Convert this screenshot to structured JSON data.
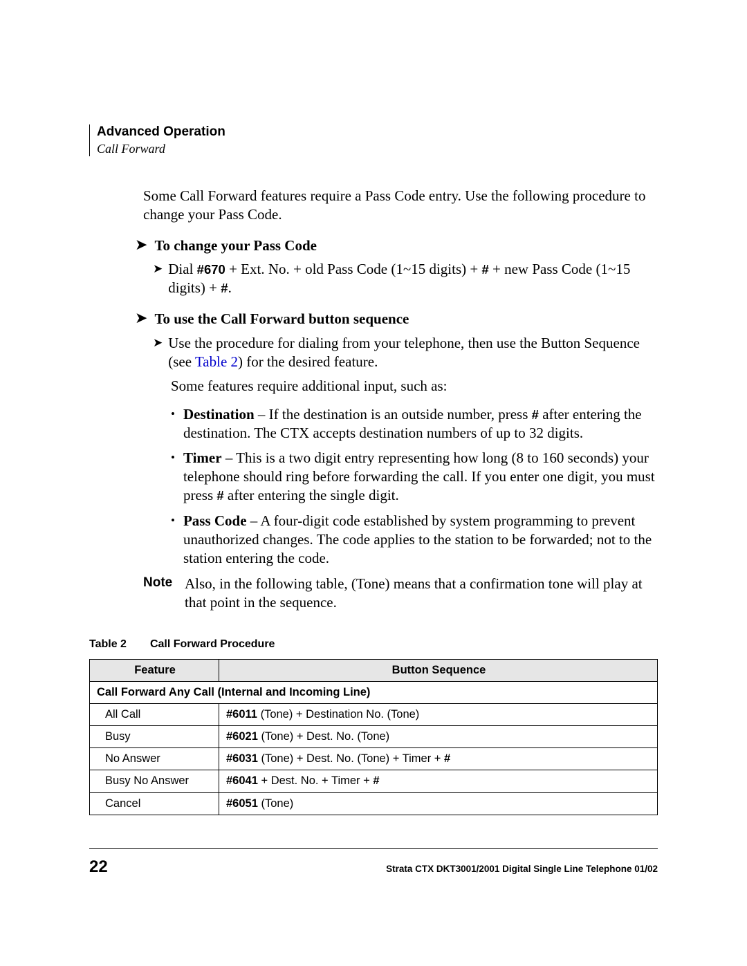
{
  "header": {
    "title": "Advanced Operation",
    "subtitle": "Call Forward"
  },
  "intro": "Some Call Forward features require a Pass Code entry. Use the following procedure to change your Pass Code.",
  "proc1": {
    "title": "To change your Pass Code",
    "step_pre": "Dial ",
    "step_code": "#670",
    "step_mid": " + Ext. No. + old Pass Code (1~15 digits) + ",
    "step_hash1": "#",
    "step_mid2": " + new Pass Code (1~15 digits) + ",
    "step_hash2": "#",
    "step_end": "."
  },
  "proc2": {
    "title": "To use the Call Forward button sequence",
    "step_a_pre": "Use the procedure for dialing from your telephone, then use the Button Sequence (see ",
    "step_a_link": "Table 2",
    "step_a_post": ") for the desired feature.",
    "step_b": "Some features require additional input, such as:",
    "bullets": {
      "dest_label": "Destination",
      "dest_pre": " – If the destination is an outside number, press ",
      "dest_hash": "#",
      "dest_post": " after entering the destination. The CTX accepts destination numbers of up to 32 digits.",
      "timer_label": "Timer",
      "timer_pre": " – This is a two digit entry representing how long (8 to 160 seconds) your telephone should ring before forwarding the call. If you enter one digit, you must press ",
      "timer_hash": "#",
      "timer_post": " after entering the single digit.",
      "pass_label": "Pass Code",
      "pass_text": " – A four-digit code established by system programming to prevent unauthorized changes. The code applies to the station to be forwarded; not to the station entering the code."
    },
    "note_label": "Note",
    "note_text": "Also, in the following table, (Tone) means that a confirmation tone will play at that point in the sequence."
  },
  "table": {
    "caption_label": "Table 2",
    "caption_title": "Call Forward Procedure",
    "h_feature": "Feature",
    "h_seq": "Button Sequence",
    "section": "Call Forward Any Call (Internal and Incoming Line)",
    "rows": [
      {
        "feature": "All Call",
        "code": "#6011",
        "rest": " (Tone) + Destination No. (Tone)"
      },
      {
        "feature": "Busy",
        "code": "#6021",
        "rest": " (Tone) + Dest. No. (Tone)"
      },
      {
        "feature": "No Answer",
        "code": "#6031",
        "rest_pre": " (Tone) + Dest. No. (Tone) + Timer + ",
        "hash": "#"
      },
      {
        "feature": "Busy No Answer",
        "code": "#6041",
        "rest_pre": " + Dest. No. + Timer + ",
        "hash": "#"
      },
      {
        "feature": "Cancel",
        "code": "#6051",
        "rest": " (Tone)"
      }
    ]
  },
  "footer": {
    "page": "22",
    "text": "Strata CTX DKT3001/2001 Digital Single Line Telephone   01/02"
  }
}
